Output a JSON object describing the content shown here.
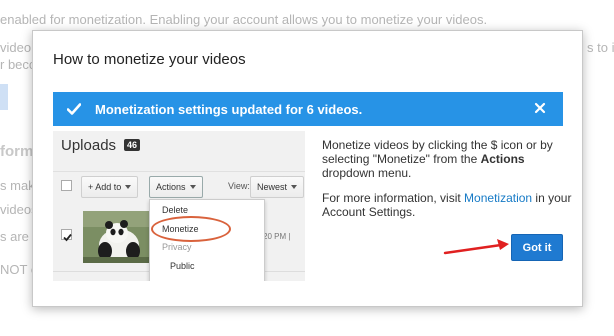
{
  "background": {
    "lines": [
      "enabled for monetization. Enabling your account allows you to monetize your videos.",
      "video",
      "r becc",
      "forma",
      "s make",
      "videos",
      "s are",
      "NOT el"
    ],
    "right_fragment": "s to in"
  },
  "modal": {
    "title": "How to monetize your videos",
    "banner": {
      "message": "Monetization settings updated for 6 videos.",
      "color": "#2793e6"
    },
    "screenshot": {
      "uploads_label": "Uploads",
      "uploads_count": "46",
      "add_to_label": "+ Add to",
      "actions_label": "Actions",
      "view_label": "View:",
      "view_value": "Newest",
      "time_fragment": "20 PM |",
      "menu": {
        "delete": "Delete",
        "monetize": "Monetize",
        "privacy_header": "Privacy",
        "public": "Public"
      }
    },
    "instructions": {
      "line1_pre": "Monetize videos by clicking the $ icon or by selecting \"Monetize\" from the ",
      "line1_bold": "Actions",
      "line1_post": " dropdown menu.",
      "line2_pre": "For more information, visit ",
      "line2_link": "Monetization",
      "line2_post": " in your Account Settings."
    },
    "got_it_label": "Got it"
  }
}
